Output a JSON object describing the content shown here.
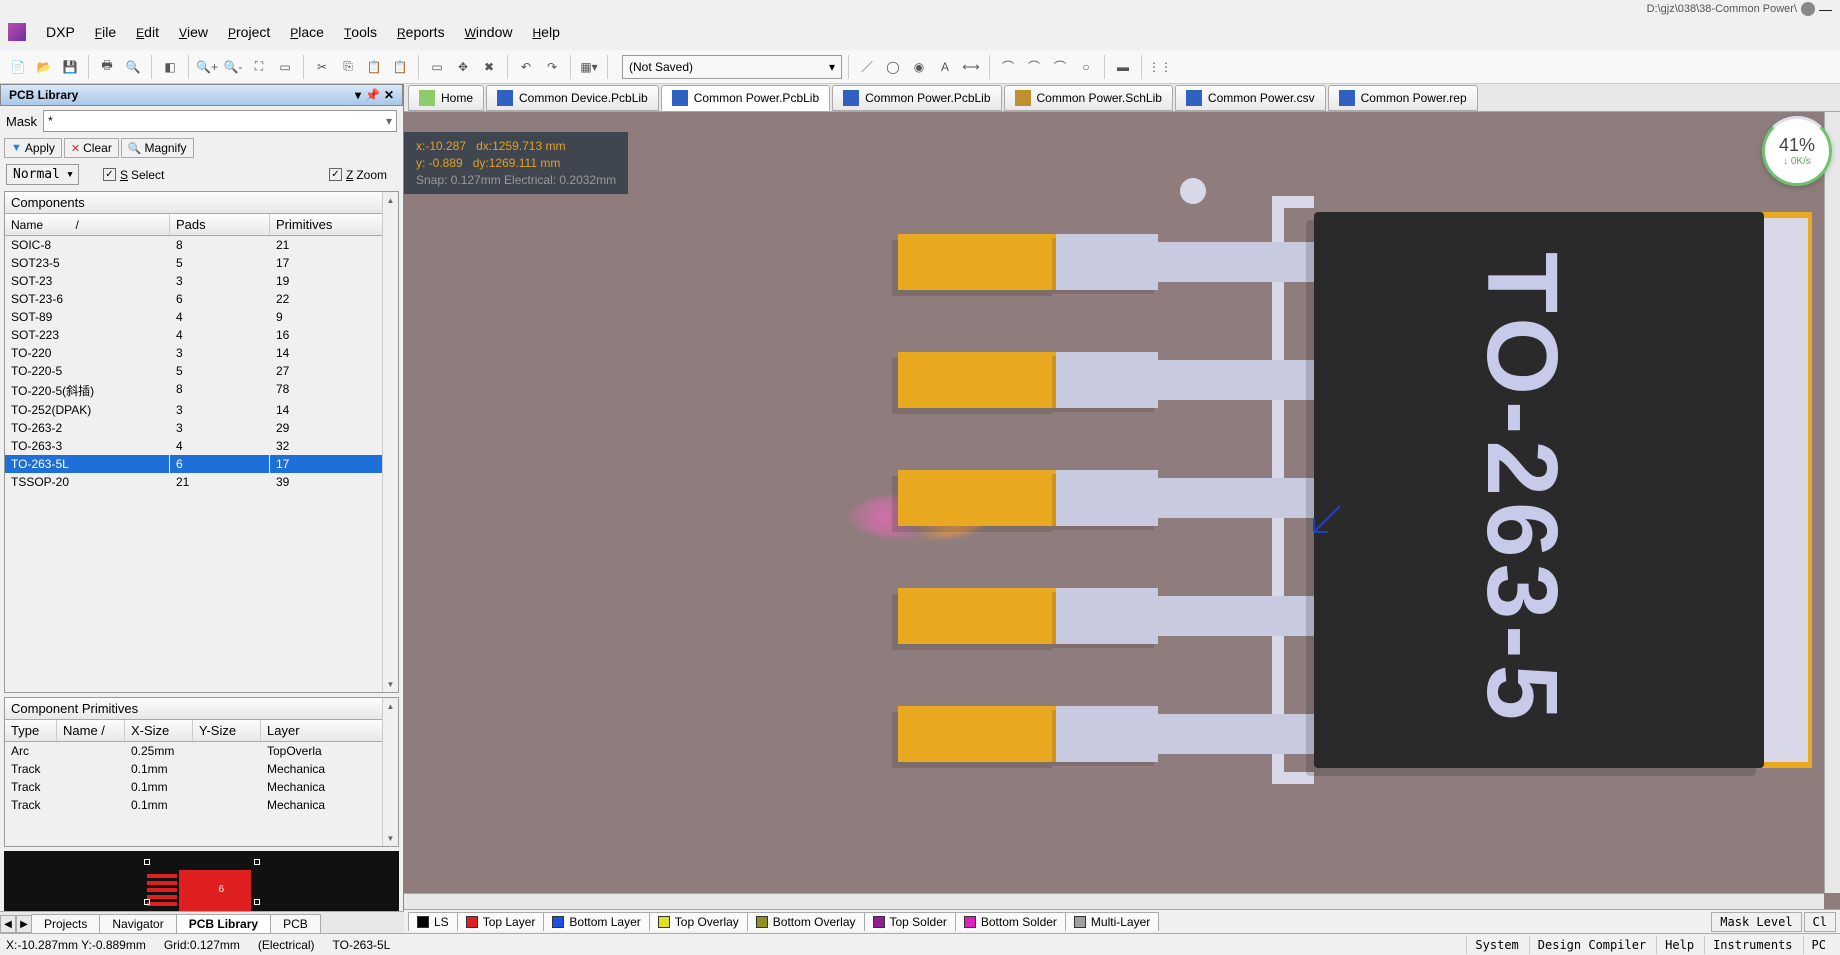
{
  "title_path": "D:\\gjz\\038\\38-Common Power\\",
  "menu": {
    "items": [
      "DXP",
      "File",
      "Edit",
      "View",
      "Project",
      "Place",
      "Tools",
      "Reports",
      "Window",
      "Help"
    ]
  },
  "toolbar": {
    "state_combo": "(Not Saved)"
  },
  "panel": {
    "title": "PCB Library",
    "mask_label": "Mask",
    "mask_value": "*",
    "apply": "Apply",
    "clear": "Clear",
    "magnify": "Magnify",
    "mode": "Normal",
    "select": "Select",
    "zoom": "Zoom",
    "components_title": "Components",
    "head": {
      "name": "Name",
      "sort": "/",
      "pads": "Pads",
      "primitives": "Primitives"
    },
    "rows": [
      {
        "name": "SOIC-8",
        "pads": "8",
        "prim": "21",
        "sel": false
      },
      {
        "name": "SOT23-5",
        "pads": "5",
        "prim": "17",
        "sel": false
      },
      {
        "name": "SOT-23",
        "pads": "3",
        "prim": "19",
        "sel": false
      },
      {
        "name": "SOT-23-6",
        "pads": "6",
        "prim": "22",
        "sel": false
      },
      {
        "name": "SOT-89",
        "pads": "4",
        "prim": "9",
        "sel": false
      },
      {
        "name": "SOT-223",
        "pads": "4",
        "prim": "16",
        "sel": false
      },
      {
        "name": "TO-220",
        "pads": "3",
        "prim": "14",
        "sel": false
      },
      {
        "name": "TO-220-5",
        "pads": "5",
        "prim": "27",
        "sel": false
      },
      {
        "name": "TO-220-5(斜插)",
        "pads": "8",
        "prim": "78",
        "sel": false
      },
      {
        "name": "TO-252(DPAK)",
        "pads": "3",
        "prim": "14",
        "sel": false
      },
      {
        "name": "TO-263-2",
        "pads": "3",
        "prim": "29",
        "sel": false
      },
      {
        "name": "TO-263-3",
        "pads": "4",
        "prim": "32",
        "sel": false
      },
      {
        "name": "TO-263-5L",
        "pads": "6",
        "prim": "17",
        "sel": true
      },
      {
        "name": "TSSOP-20",
        "pads": "21",
        "prim": "39",
        "sel": false
      }
    ],
    "primitives_title": "Component Primitives",
    "prim_head": {
      "type": "Type",
      "name": "Name /",
      "xsize": "X-Size",
      "ysize": "Y-Size",
      "layer": "Layer"
    },
    "prim_rows": [
      {
        "type": "Arc",
        "name": "",
        "xsize": "0.25mm",
        "ysize": "",
        "layer": "TopOverla"
      },
      {
        "type": "Track",
        "name": "",
        "xsize": "0.1mm",
        "ysize": "",
        "layer": "Mechanica"
      },
      {
        "type": "Track",
        "name": "",
        "xsize": "0.1mm",
        "ysize": "",
        "layer": "Mechanica"
      },
      {
        "type": "Track",
        "name": "",
        "xsize": "0.1mm",
        "ysize": "",
        "layer": "Mechanica"
      }
    ],
    "thumb_designator": "6"
  },
  "left_tabs": [
    "Projects",
    "Navigator",
    "PCB Library",
    "PCB"
  ],
  "left_tab_active": 2,
  "doc_tabs": [
    {
      "label": "Home",
      "icon": "home",
      "active": false
    },
    {
      "label": "Common Device.PcbLib",
      "icon": "pcb",
      "active": false
    },
    {
      "label": "Common Power.PcbLib",
      "icon": "pcb",
      "active": true
    },
    {
      "label": "Common Power.PcbLib",
      "icon": "pcb",
      "active": false
    },
    {
      "label": "Common Power.SchLib",
      "icon": "sch",
      "active": false
    },
    {
      "label": "Common Power.csv",
      "icon": "csv",
      "active": false
    },
    {
      "label": "Common Power.rep",
      "icon": "csv",
      "active": false
    }
  ],
  "coords": {
    "x": "x:-10.287",
    "dx": "dx:1259.713 mm",
    "y": "y: -0.889",
    "dy": "dy:1269.111 mm",
    "snap": "Snap: 0.127mm Electrical: 0.2032mm"
  },
  "component_label": "TO-263-5",
  "speed": {
    "pct": "41%",
    "rate": "↓ 0K/s"
  },
  "layers": [
    {
      "name": "LS",
      "color": "#000000"
    },
    {
      "name": "Top Layer",
      "color": "#e02020"
    },
    {
      "name": "Bottom Layer",
      "color": "#2050e0"
    },
    {
      "name": "Top Overlay",
      "color": "#e0e020"
    },
    {
      "name": "Bottom Overlay",
      "color": "#909020"
    },
    {
      "name": "Top Solder",
      "color": "#902090"
    },
    {
      "name": "Bottom Solder",
      "color": "#e020c0"
    },
    {
      "name": "Multi-Layer",
      "color": "#a0a0a0"
    }
  ],
  "layer_right": [
    "Mask Level",
    "Cl"
  ],
  "status": {
    "xy": "X:-10.287mm Y:-0.889mm",
    "grid": "Grid:0.127mm",
    "hotspot": "(Electrical)",
    "comp": "TO-263-5L",
    "right": [
      "System",
      "Design Compiler",
      "Help",
      "Instruments",
      "PC"
    ]
  }
}
